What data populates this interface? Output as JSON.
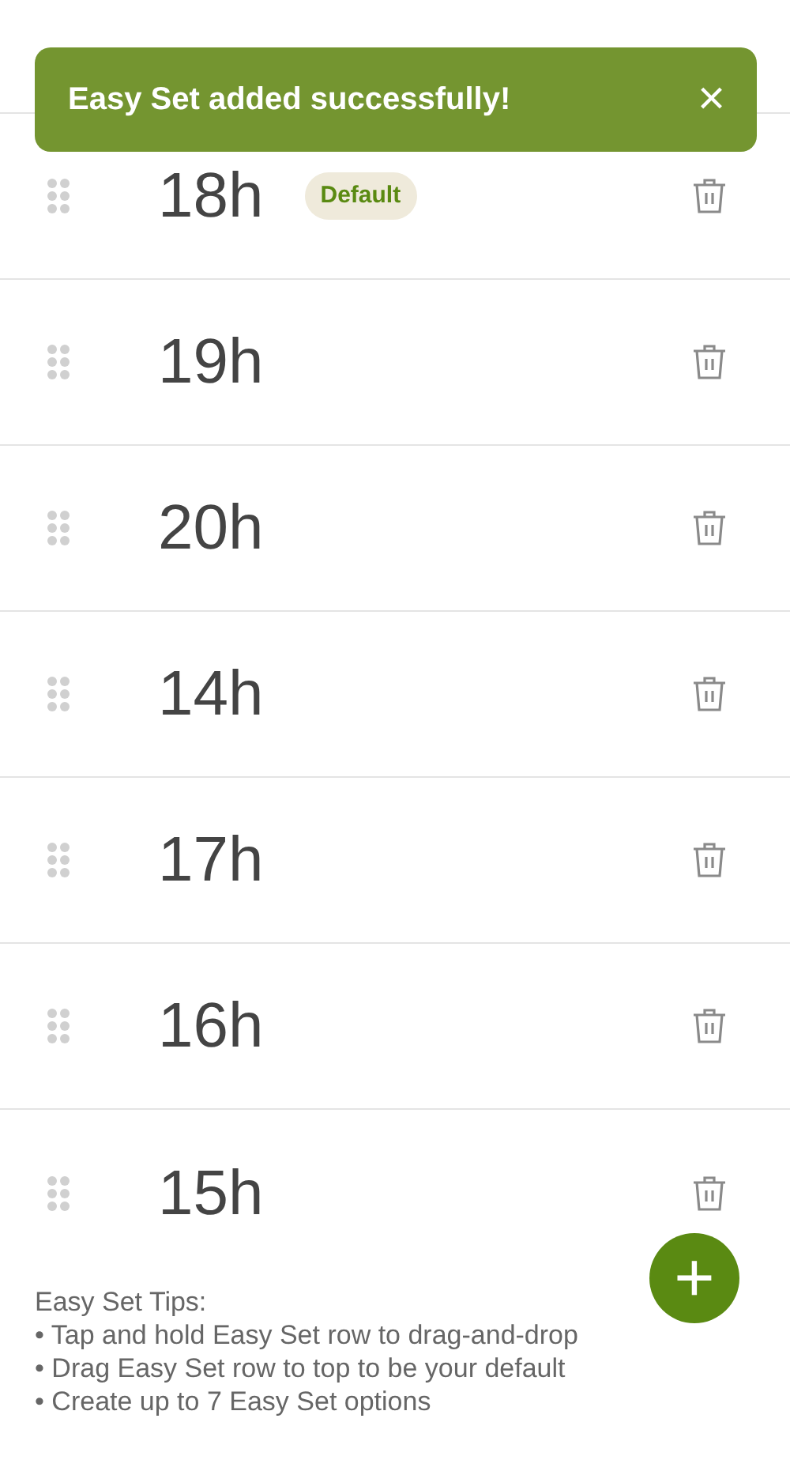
{
  "toast": {
    "message": "Easy Set added successfully!",
    "close": "×"
  },
  "easy_sets": [
    {
      "label": "18h",
      "badge": "Default"
    },
    {
      "label": "19h"
    },
    {
      "label": "20h"
    },
    {
      "label": "14h"
    },
    {
      "label": "17h"
    },
    {
      "label": "16h"
    },
    {
      "label": "15h"
    }
  ],
  "tips": {
    "title": "Easy Set Tips:",
    "items": [
      "• Tap and hold Easy Set row to drag-and-drop",
      "• Drag Easy Set row to top to be your default",
      "• Create up to 7 Easy Set options"
    ]
  },
  "add_button": "+"
}
